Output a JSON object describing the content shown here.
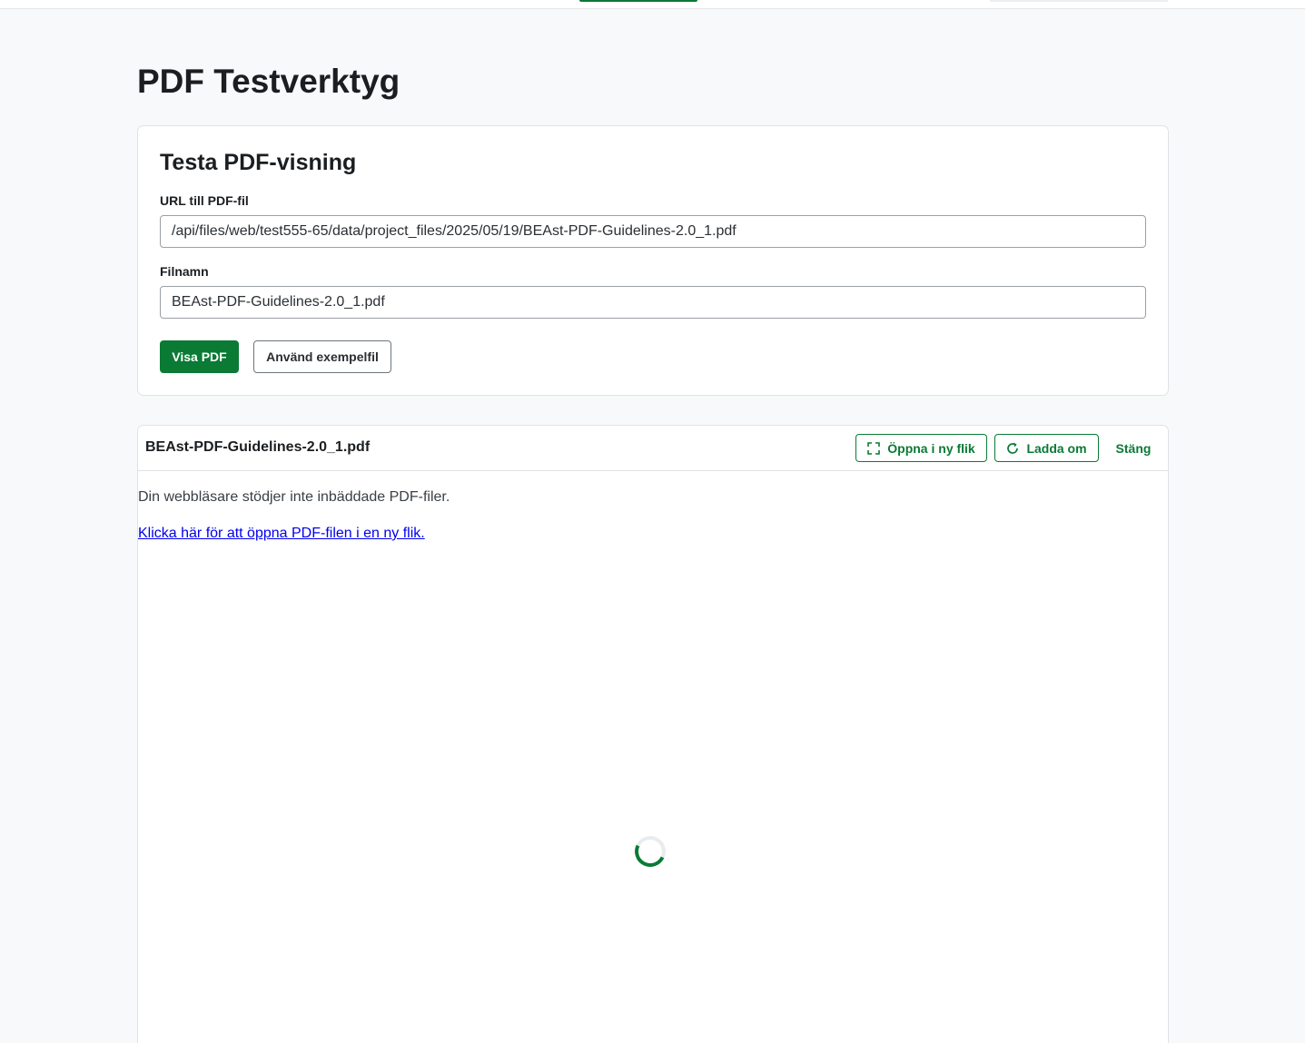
{
  "page": {
    "title": "PDF Testverktyg"
  },
  "form": {
    "heading": "Testa PDF-visning",
    "url_label": "URL till PDF-fil",
    "url_value": "/api/files/web/test555-65/data/project_files/2025/05/19/BEAst-PDF-Guidelines-2.0_1.pdf",
    "filename_label": "Filnamn",
    "filename_value": "BEAst-PDF-Guidelines-2.0_1.pdf",
    "show_button": "Visa PDF",
    "example_button": "Använd exempelfil"
  },
  "viewer": {
    "filename": "BEAst-PDF-Guidelines-2.0_1.pdf",
    "open_tab_button": "Öppna i ny flik",
    "open_tab_icon": "expand-icon",
    "reload_button": "Ladda om",
    "reload_icon": "reload-icon",
    "close_button": "Stäng",
    "fallback_text": "Din webbläsare stödjer inte inbäddade PDF-filer.",
    "fallback_link": "Klicka här för att öppna PDF-filen i en ny flik.",
    "loading": true
  },
  "colors": {
    "accent": "#0a7a35",
    "background": "#f8f9fa",
    "link": "#0000ee"
  }
}
